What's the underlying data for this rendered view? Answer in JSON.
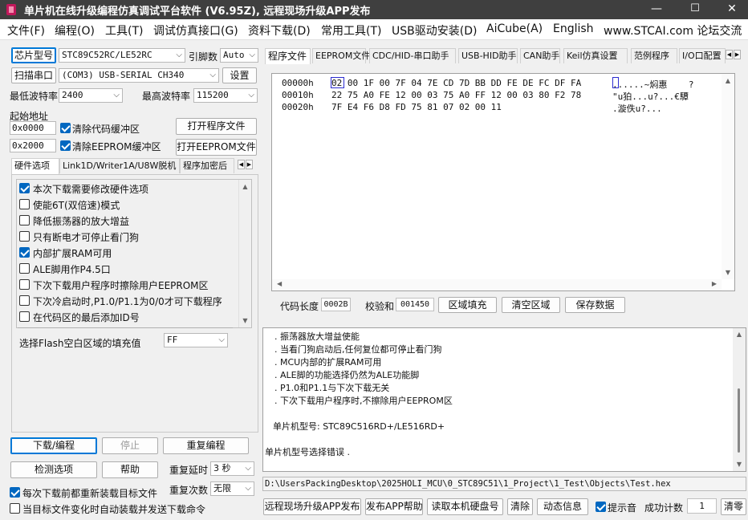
{
  "window": {
    "title": "单片机在线升级编程仿真调试平台软件 (V6.95Z), 远程现场升级APP发布",
    "minimize": "—",
    "maximize": "☐",
    "close": "✕"
  },
  "menu": [
    "文件(F)",
    "编程(O)",
    "工具(T)",
    "调试仿真接口(G)",
    "资料下载(D)",
    "常用工具(T)",
    "USB驱动安装(D)",
    "AiCube(A)",
    "English",
    "www.STCAI.com 论坛交流"
  ],
  "left": {
    "chip_model_btn": "芯片型号",
    "chip_model_value": "STC89C52RC/LE52RC",
    "pin_count_label": "引脚数",
    "pin_count_value": "Auto",
    "scan_port_btn": "扫描串口",
    "port_value": "(COM3) USB-SERIAL CH340",
    "settings_btn": "设置",
    "min_baud_label": "最低波特率",
    "min_baud_value": "2400",
    "max_baud_label": "最高波特率",
    "max_baud_value": "115200",
    "start_addr_label": "起始地址",
    "addr1": "0x0000",
    "clear_code_label": "清除代码缓冲区",
    "open_program_btn": "打开程序文件",
    "addr2": "0x2000",
    "clear_eeprom_label": "清除EEPROM缓冲区",
    "open_eeprom_btn": "打开EEPROM文件",
    "tabs": [
      "硬件选项",
      "Link1D/Writer1A/U8W脱机",
      "程序加密后"
    ],
    "options": [
      {
        "label": "本次下载需要修改硬件选项",
        "checked": true
      },
      {
        "label": "使能6T(双倍速)模式",
        "checked": false
      },
      {
        "label": "降低振荡器的放大增益",
        "checked": false
      },
      {
        "label": "只有断电才可停止看门狗",
        "checked": false
      },
      {
        "label": "内部扩展RAM可用",
        "checked": true
      },
      {
        "label": "ALE脚用作P4.5口",
        "checked": false
      },
      {
        "label": "下次下载用户程序时擦除用户EEPROM区",
        "checked": false
      },
      {
        "label": "下次冷启动时,P1.0/P1.1为0/0才可下载程序",
        "checked": false
      },
      {
        "label": "在代码区的最后添加ID号",
        "checked": false
      }
    ],
    "fill_label": "选择Flash空白区域的填充值",
    "fill_value": "FF",
    "download_btn": "下载/编程",
    "stop_btn": "停止",
    "reprogram_btn": "重复编程",
    "check_btn": "检测选项",
    "help_btn": "帮助",
    "repeat_delay_label": "重复延时",
    "repeat_delay_value": "3 秒",
    "repeat_count_label": "重复次数",
    "repeat_count_value": "无限",
    "reload_label": "每次下载前都重新装载目标文件",
    "reload_checked": true,
    "auto_label": "当目标文件变化时自动装载并发送下载命令",
    "auto_checked": false
  },
  "right": {
    "tabs": [
      "程序文件",
      "EEPROM文件",
      "CDC/HID-串口助手",
      "USB-HID助手",
      "CAN助手",
      "Keil仿真设置",
      "范例程序",
      "I/O口配置"
    ],
    "hex": [
      {
        "addr": "00000h",
        "bytes": "02 00 1F 00 7F 04 7E CD 7D BB DD FE DE FC DF FA",
        "ascii": "......~焖惠    ?"
      },
      {
        "addr": "00010h",
        "bytes": "22 75 A0 FE 12 00 03 75 A0 FF 12 00 03 80 F2 78",
        "ascii": "\"u狛...u?...€驔"
      },
      {
        "addr": "00020h",
        "bytes": "7F E4 F6 D8 FD 75 81 07 02 00 11",
        "ascii": ".漩佚u?..."
      }
    ],
    "code_len_label": "代码长度",
    "code_len_value": "0002B",
    "checksum_label": "校验和",
    "checksum_value": "001450",
    "fill_area_btn": "区域填充",
    "clear_area_btn": "清空区域",
    "save_data_btn": "保存数据",
    "log": [
      ". 振荡器放大增益使能",
      ". 当看门狗启动后,任何复位都可停止看门狗",
      ". MCU内部的扩展RAM可用",
      ". ALE脚的功能选择仍然为ALE功能脚",
      ". P1.0和P1.1与下次下载无关",
      ". 下次下载用户程序时,不擦除用户EEPROM区",
      "",
      "单片机型号: STC89C516RD+/LE516RD+",
      "",
      "单片机型号选择错误 ."
    ],
    "file_path": "D:\\UsersPackingDesktop\\2025HOLI_MCU\\0_STC89C51\\1_Project\\1_Test\\Objects\\Test.hex",
    "bottom": {
      "remote_btn": "远程现场升级APP发布",
      "publish_help_btn": "发布APP帮助",
      "read_disk_btn": "读取本机硬盘号",
      "clear_btn": "清除",
      "dynamic_btn": "动态信息",
      "beep_label": "提示音",
      "beep_checked": true,
      "success_label": "成功计数",
      "success_value": "1",
      "clear_zero_btn": "清零"
    }
  }
}
